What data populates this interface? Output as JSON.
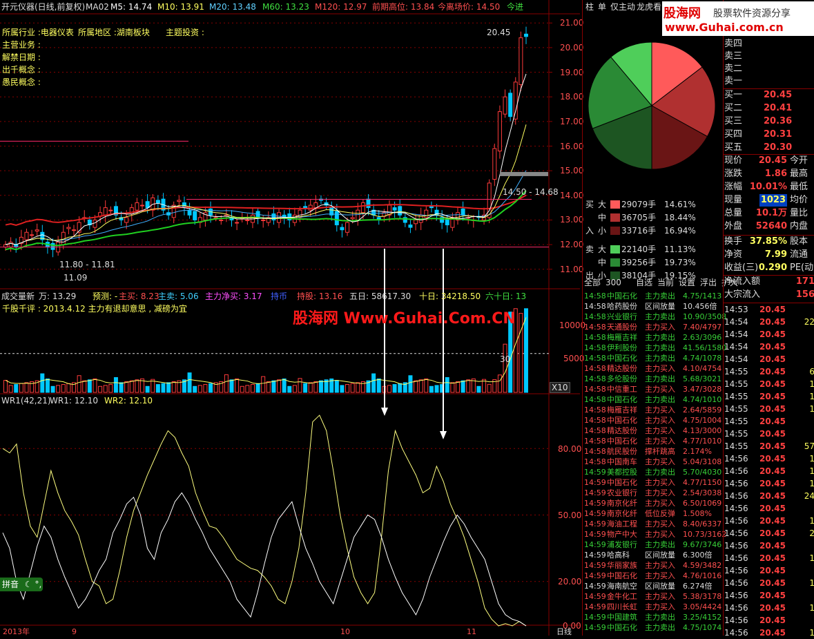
{
  "chart_header": {
    "name": "开元仪器(日线,前复权)",
    "ma_label": "MA02",
    "m5": "M5: 14.74",
    "m10": "M10: 13.91",
    "m20": "M20: 13.48",
    "m60": "M60: 13.23",
    "m120": "M120: 12.97",
    "prev_high": "前期高位: 13.84",
    "lift_price": "今离场价: 14.50",
    "today_in": "今进"
  },
  "info_lines": {
    "industry": "所属行业 :电器仪表",
    "region": "所属地区 :湖南板块",
    "theme": "主题投资 :",
    "business": "主营业务 :",
    "unlock": "解禁日期 :",
    "concept1": "出千概念 :",
    "concept2": "愚民概念 :"
  },
  "price_axis": [
    "21.00",
    "20.00",
    "19.00",
    "18.00",
    "17.00",
    "16.00",
    "15.00",
    "14.00",
    "13.00",
    "12.00",
    "11.00"
  ],
  "price_annotations": {
    "high": "20.45",
    "low_range": "11.80 - 11.81",
    "low": "11.09",
    "range_right": "14.50 - 14.68"
  },
  "volume_header": {
    "title": "成交量新",
    "unit": "万: 13.29",
    "predict": "预测: -",
    "main_buy": "主买: 8.23",
    "main_sell": "主卖: 5.06",
    "net_buy": "主力净买: 3.17",
    "coins": "持币",
    "hold": "持股: 13.16",
    "d5": "五日: 58617.30",
    "d10": "十日: 34218.50",
    "d60": "六十日: 13"
  },
  "volume_comment": "千股千评 : 2013.4.12 主力有退却意思 , 减磅为宜",
  "watermark": "股海网 Www.Guhai.Com.CN",
  "volume_axis": [
    "10000",
    "5000"
  ],
  "volume_multiplier": "X10",
  "volume_value_label": "30",
  "wr_header": {
    "title": "WR1(42,21)",
    "wr1": "WR1: 12.10",
    "wr2": "WR2: 12.10"
  },
  "wr_axis": [
    "80.00",
    "50.00",
    "20.00",
    "0.00"
  ],
  "ime_label": "拼音",
  "bottom_axis": [
    "2013年",
    "9",
    "",
    "10",
    "",
    "11"
  ],
  "bottom_right": "日线",
  "chart_data": [
    {
      "type": "line",
      "title": "开元仪器(日线,前复权)",
      "ylim": [
        10.6,
        21.4
      ],
      "x": [
        1,
        2,
        3,
        4,
        5,
        6,
        7,
        8,
        9,
        10,
        11,
        12,
        13,
        14,
        15,
        16,
        17,
        18,
        19,
        20,
        21,
        22,
        23,
        24,
        25,
        26,
        27,
        28,
        29,
        30,
        31,
        32,
        33,
        34,
        35,
        36,
        37,
        38,
        39,
        40,
        41,
        42,
        43,
        44,
        45,
        46,
        47,
        48,
        49,
        50,
        51,
        52,
        53,
        54,
        55,
        56,
        57,
        58,
        59,
        60,
        61,
        62,
        63,
        64,
        65,
        66,
        67,
        68,
        69,
        70,
        71,
        72,
        73,
        74,
        75,
        76,
        77,
        78,
        79,
        80,
        81,
        82,
        83,
        84,
        85,
        86,
        87,
        88,
        89,
        90,
        91,
        92,
        93,
        94,
        95,
        96,
        97,
        98,
        99,
        100
      ],
      "series": [
        {
          "name": "close",
          "values": [
            12.0,
            12.1,
            11.9,
            12.3,
            12.5,
            12.4,
            12.6,
            12.2,
            11.9,
            11.8,
            12.1,
            12.5,
            12.7,
            12.6,
            12.9,
            13.1,
            12.8,
            13.0,
            13.3,
            13.5,
            13.4,
            13.2,
            13.0,
            13.1,
            13.5,
            13.7,
            13.6,
            13.5,
            13.9,
            13.7,
            13.4,
            13.2,
            13.6,
            13.8,
            13.5,
            13.2,
            13.0,
            13.1,
            13.3,
            13.2,
            13.1,
            13.0,
            13.2,
            13.0,
            12.9,
            13.1,
            13.0,
            13.2,
            13.1,
            13.0,
            13.1,
            13.0,
            13.3,
            13.1,
            13.0,
            13.2,
            13.4,
            13.5,
            13.6,
            13.7,
            13.8,
            13.6,
            13.2,
            12.8,
            12.6,
            12.9,
            13.1,
            13.4,
            13.7,
            13.5,
            13.2,
            13.0,
            13.3,
            13.6,
            13.4,
            13.2,
            12.9,
            12.7,
            13.0,
            13.2,
            13.4,
            13.5,
            13.2,
            12.9,
            12.8,
            13.1,
            13.3,
            13.2,
            13.1,
            13.0,
            13.1,
            13.2,
            14.5,
            15.9,
            17.4,
            18.0,
            17.2,
            18.6,
            20.4,
            20.45
          ]
        }
      ]
    },
    {
      "type": "line",
      "title": "WR1(42,21)",
      "ylim": [
        0,
        100
      ],
      "series": [
        {
          "name": "WR1",
          "values": [
            80,
            78,
            82,
            60,
            45,
            40,
            55,
            70,
            60,
            52,
            47,
            41,
            30,
            20,
            18,
            10,
            12,
            25,
            40,
            52,
            60,
            68,
            75,
            82,
            88,
            85,
            78,
            72,
            60,
            52,
            45,
            44,
            40,
            35,
            30,
            28,
            26,
            25,
            22,
            18,
            12,
            10,
            20,
            35,
            60,
            92,
            95,
            88,
            70,
            50,
            35,
            22,
            15,
            10,
            15,
            40,
            70,
            88,
            80,
            74,
            68,
            60,
            62,
            72,
            65,
            55,
            48,
            40,
            30,
            20,
            8,
            3,
            0,
            1,
            0,
            2,
            0
          ]
        },
        {
          "name": "WR2",
          "values": [
            42,
            35,
            20,
            12,
            24,
            36,
            45,
            40,
            30,
            22,
            15,
            8,
            12,
            18,
            25,
            30,
            42,
            48,
            55,
            58,
            50,
            35,
            30,
            42,
            48,
            56,
            60,
            55,
            48,
            42,
            35,
            30,
            25,
            20,
            12,
            8,
            4,
            15,
            28,
            40,
            48,
            52,
            56,
            45,
            35,
            28,
            20,
            15,
            10,
            20,
            30,
            40,
            45,
            50,
            48,
            40,
            30,
            22,
            15,
            10,
            5,
            12,
            22,
            30,
            38,
            45,
            50,
            46,
            40,
            35,
            30,
            20,
            10,
            5,
            3,
            2,
            0
          ]
        }
      ]
    }
  ],
  "right_tabs": [
    "柱",
    "单",
    "仅主动",
    "龙虎看"
  ],
  "guhai_logo": {
    "cn": "股海网",
    "sub": "股票软件资源分享",
    "url": "www.Guhai.com.cn"
  },
  "order_book_sell": [
    "卖四",
    "卖三",
    "卖二",
    "卖一"
  ],
  "order_book_buy": [
    {
      "label": "买一",
      "price": "20.45"
    },
    {
      "label": "买二",
      "price": "20.41"
    },
    {
      "label": "买三",
      "price": "20.36"
    },
    {
      "label": "买四",
      "price": "20.31"
    },
    {
      "label": "买五",
      "price": "20.30"
    }
  ],
  "quote": [
    {
      "label": "现价",
      "value": "20.45",
      "label2": "今开"
    },
    {
      "label": "涨跌",
      "value": "1.86",
      "label2": "最高"
    },
    {
      "label": "涨幅",
      "value": "10.01%",
      "label2": "最低"
    },
    {
      "label": "现量",
      "value": "1023",
      "label2": "均价"
    },
    {
      "label": "总量",
      "value": "10.1万",
      "label2": "量比"
    },
    {
      "label": "外盘",
      "value": "52640",
      "label2": "内盘"
    }
  ],
  "quote2": [
    {
      "label": "换手",
      "value": "37.85%",
      "label2": "股本"
    },
    {
      "label": "净资",
      "value": "7.99",
      "label2": "流通"
    },
    {
      "label": "收益(三)",
      "value": "0.290",
      "label2": "PE(动"
    }
  ],
  "net_flow": [
    {
      "label": "净流入额",
      "value": "171"
    },
    {
      "label": "大宗流入",
      "value": "156"
    }
  ],
  "flow_rows": [
    {
      "side": "买",
      "size": "大",
      "amount": "29079手",
      "pct": "14.61%",
      "color": "#ff5a5a"
    },
    {
      "side": "",
      "size": "中",
      "amount": "36705手",
      "pct": "18.44%",
      "color": "#b03030"
    },
    {
      "side": "入",
      "size": "小",
      "amount": "33716手",
      "pct": "16.94%",
      "color": "#6a1515"
    },
    {
      "side": "卖",
      "size": "大",
      "amount": "22140手",
      "pct": "11.13%",
      "color": "#4fce5a"
    },
    {
      "side": "",
      "size": "中",
      "amount": "39256手",
      "pct": "19.73%",
      "color": "#2a8a35"
    },
    {
      "side": "出",
      "size": "小",
      "amount": "38104手",
      "pct": "19.15%",
      "color": "#1d5522"
    }
  ],
  "pie": {
    "slices": [
      {
        "value": 14.61,
        "color": "#ff5a5a"
      },
      {
        "value": 18.44,
        "color": "#b03030"
      },
      {
        "value": 16.94,
        "color": "#6a1515"
      },
      {
        "value": 19.15,
        "color": "#1d5522"
      },
      {
        "value": 19.73,
        "color": "#2a8a35"
      },
      {
        "value": 11.13,
        "color": "#4fce5a"
      }
    ]
  },
  "bottom_tabs": [
    "全部",
    "300",
    "自选",
    "当前",
    "设置",
    "浮出",
    "扩大"
  ],
  "radar": [
    {
      "time": "14:58",
      "name": "中国石化",
      "type": "主力卖出",
      "val": "4.75/1413",
      "tc": "#38d038",
      "ty": "#38d038"
    },
    {
      "time": "14:58",
      "name": "哈药股份",
      "type": "区间放量",
      "val": "10.456倍",
      "tc": "#ddd",
      "ty": "#ddd"
    },
    {
      "time": "14:58",
      "name": "兴业银行",
      "type": "主力卖出",
      "val": "10.90/3508",
      "tc": "#38d038",
      "ty": "#38d038"
    },
    {
      "time": "14:58",
      "name": "天通股份",
      "type": "主力买入",
      "val": "7.40/4797",
      "tc": "#ff5050",
      "ty": "#ff5050"
    },
    {
      "time": "14:58",
      "name": "梅雁吉祥",
      "type": "主力卖出",
      "val": "2.63/3096",
      "tc": "#38d038",
      "ty": "#38d038"
    },
    {
      "time": "14:58",
      "name": "伊利股份",
      "type": "主力卖出",
      "val": "41.56/1580",
      "tc": "#38d038",
      "ty": "#38d038"
    },
    {
      "time": "14:58",
      "name": "中国石化",
      "type": "主力卖出",
      "val": "4.74/1078",
      "tc": "#38d038",
      "ty": "#38d038"
    },
    {
      "time": "14:58",
      "name": "精达股份",
      "type": "主力买入",
      "val": "4.10/4754",
      "tc": "#ff5050",
      "ty": "#ff5050"
    },
    {
      "time": "14:58",
      "name": "多伦股份",
      "type": "主力卖出",
      "val": "5.68/3021",
      "tc": "#38d038",
      "ty": "#38d038"
    },
    {
      "time": "14:58",
      "name": "中信重工",
      "type": "主力买入",
      "val": "3.47/3028",
      "tc": "#ff5050",
      "ty": "#ff5050"
    },
    {
      "time": "14:58",
      "name": "中国石化",
      "type": "主力卖出",
      "val": "4.74/1010",
      "tc": "#38d038",
      "ty": "#38d038"
    },
    {
      "time": "14:58",
      "name": "梅雁吉祥",
      "type": "主力买入",
      "val": "2.64/5859",
      "tc": "#ff5050",
      "ty": "#ff5050"
    },
    {
      "time": "14:58",
      "name": "中国石化",
      "type": "主力买入",
      "val": "4.75/1004",
      "tc": "#ff5050",
      "ty": "#ff5050"
    },
    {
      "time": "14:58",
      "name": "精达股份",
      "type": "主力买入",
      "val": "4.13/3000",
      "tc": "#ff5050",
      "ty": "#ff5050"
    },
    {
      "time": "14:58",
      "name": "中国石化",
      "type": "主力买入",
      "val": "4.77/1010",
      "tc": "#ff5050",
      "ty": "#ff5050"
    },
    {
      "time": "14:58",
      "name": "航民股份",
      "type": "撑杆跳高",
      "val": "2.174%",
      "tc": "#ff5050",
      "ty": "#ff5050"
    },
    {
      "time": "14:58",
      "name": "中国南车",
      "type": "主力买入",
      "val": "5.04/3108",
      "tc": "#ff5050",
      "ty": "#ff5050"
    },
    {
      "time": "14:59",
      "name": "美都控股",
      "type": "主力卖出",
      "val": "5.70/4030",
      "tc": "#38d038",
      "ty": "#38d038"
    },
    {
      "time": "14:59",
      "name": "中国石化",
      "type": "主力买入",
      "val": "4.77/1150",
      "tc": "#ff5050",
      "ty": "#ff5050"
    },
    {
      "time": "14:59",
      "name": "农业银行",
      "type": "主力买入",
      "val": "2.54/3038",
      "tc": "#ff5050",
      "ty": "#ff5050"
    },
    {
      "time": "14:59",
      "name": "南京化纤",
      "type": "主力买入",
      "val": "6.50/1069",
      "tc": "#ff5050",
      "ty": "#ff5050"
    },
    {
      "time": "14:59",
      "name": "南京化纤",
      "type": "低位反弹",
      "val": "1.508%",
      "tc": "#ff5050",
      "ty": "#ff5050"
    },
    {
      "time": "14:59",
      "name": "海油工程",
      "type": "主力买入",
      "val": "8.40/6337",
      "tc": "#ff5050",
      "ty": "#ff5050"
    },
    {
      "time": "14:59",
      "name": "物产中大",
      "type": "主力买入",
      "val": "10.73/3162",
      "tc": "#ff5050",
      "ty": "#ff5050"
    },
    {
      "time": "14:59",
      "name": "浦发银行",
      "type": "主力卖出",
      "val": "9.67/3746",
      "tc": "#38d038",
      "ty": "#38d038"
    },
    {
      "time": "14:59",
      "name": "哈高科",
      "type": "区间放量",
      "val": "6.300倍",
      "tc": "#ddd",
      "ty": "#ddd"
    },
    {
      "time": "14:59",
      "name": "华丽家族",
      "type": "主力买入",
      "val": "4.59/3482",
      "tc": "#ff5050",
      "ty": "#ff5050"
    },
    {
      "time": "14:59",
      "name": "中国石化",
      "type": "主力买入",
      "val": "4.76/1016",
      "tc": "#ff5050",
      "ty": "#ff5050"
    },
    {
      "time": "14:59",
      "name": "海南航空",
      "type": "区间放量",
      "val": "6.274倍",
      "tc": "#ddd",
      "ty": "#ddd"
    },
    {
      "time": "14:59",
      "name": "金牛化工",
      "type": "主力买入",
      "val": "5.38/3178",
      "tc": "#ff5050",
      "ty": "#ff5050"
    },
    {
      "time": "14:59",
      "name": "四川长虹",
      "type": "主力买入",
      "val": "3.05/4424",
      "tc": "#ff5050",
      "ty": "#ff5050"
    },
    {
      "time": "14:59",
      "name": "中国建筑",
      "type": "主力卖出",
      "val": "3.25/4152",
      "tc": "#38d038",
      "ty": "#38d038"
    },
    {
      "time": "14:59",
      "name": "中国石化",
      "type": "主力卖出",
      "val": "4.75/1074",
      "tc": "#38d038",
      "ty": "#38d038"
    }
  ],
  "ticks": [
    {
      "time": "14:53",
      "price": "20.45",
      "vol": ""
    },
    {
      "time": "14:54",
      "price": "20.45",
      "vol": "22"
    },
    {
      "time": "14:54",
      "price": "20.45",
      "vol": ""
    },
    {
      "time": "14:54",
      "price": "20.45",
      "vol": ""
    },
    {
      "time": "14:54",
      "price": "20.45",
      "vol": ""
    },
    {
      "time": "14:55",
      "price": "20.45",
      "vol": "6"
    },
    {
      "time": "14:55",
      "price": "20.45",
      "vol": "1"
    },
    {
      "time": "14:55",
      "price": "20.45",
      "vol": "1"
    },
    {
      "time": "14:55",
      "price": "20.45",
      "vol": "1"
    },
    {
      "time": "14:55",
      "price": "20.45",
      "vol": ""
    },
    {
      "time": "14:55",
      "price": "20.45",
      "vol": ""
    },
    {
      "time": "14:55",
      "price": "20.45",
      "vol": "57"
    },
    {
      "time": "14:56",
      "price": "20.45",
      "vol": "1"
    },
    {
      "time": "14:56",
      "price": "20.45",
      "vol": "1"
    },
    {
      "time": "14:56",
      "price": "20.45",
      "vol": "1"
    },
    {
      "time": "14:56",
      "price": "20.45",
      "vol": "24"
    },
    {
      "time": "14:56",
      "price": "20.45",
      "vol": ""
    },
    {
      "time": "14:56",
      "price": "20.45",
      "vol": "1"
    },
    {
      "time": "14:56",
      "price": "20.45",
      "vol": "2"
    },
    {
      "time": "14:56",
      "price": "20.45",
      "vol": ""
    },
    {
      "time": "14:56",
      "price": "20.45",
      "vol": "1"
    },
    {
      "time": "14:56",
      "price": "20.45",
      "vol": ""
    },
    {
      "time": "14:56",
      "price": "20.45",
      "vol": "1"
    },
    {
      "time": "14:56",
      "price": "20.45",
      "vol": ""
    },
    {
      "time": "14:56",
      "price": "20.45",
      "vol": "1"
    },
    {
      "time": "14:56",
      "price": "20.45",
      "vol": ""
    },
    {
      "time": "14:56",
      "price": "20.45",
      "vol": "1"
    }
  ],
  "colors": {
    "up": "#ff3b3b",
    "down": "#00c8ff",
    "grid": "#8a0000",
    "yellow": "#ffff60",
    "green": "#20d020"
  }
}
